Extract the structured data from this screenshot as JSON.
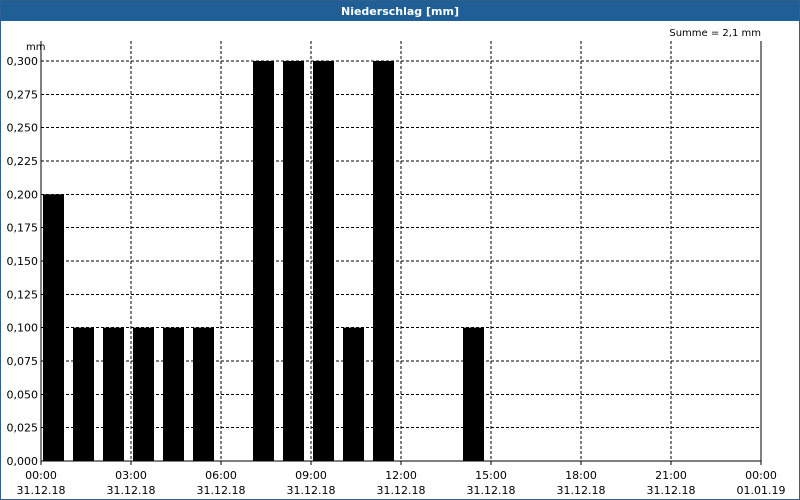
{
  "window": {
    "title": "Niederschlag [mm]"
  },
  "chart_data": {
    "type": "bar",
    "title": "Niederschlag [mm]",
    "unit": "mm",
    "summary": "Summe = 2,1 mm",
    "ylim": [
      0,
      0.3
    ],
    "y_ticks": [
      "0,000",
      "0,025",
      "0,050",
      "0,075",
      "0,100",
      "0,125",
      "0,150",
      "0,175",
      "0,200",
      "0,225",
      "0,250",
      "0,275",
      "0,300"
    ],
    "x_ticks": [
      {
        "time": "00:00",
        "date": "31.12.18"
      },
      {
        "time": "03:00",
        "date": "31.12.18"
      },
      {
        "time": "06:00",
        "date": "31.12.18"
      },
      {
        "time": "09:00",
        "date": "31.12.18"
      },
      {
        "time": "12:00",
        "date": "31.12.18"
      },
      {
        "time": "15:00",
        "date": "31.12.18"
      },
      {
        "time": "18:00",
        "date": "31.12.18"
      },
      {
        "time": "21:00",
        "date": "31.12.18"
      },
      {
        "time": "00:00",
        "date": "01.01.19"
      }
    ],
    "categories": [
      "00:00",
      "01:00",
      "02:00",
      "03:00",
      "04:00",
      "05:00",
      "06:00",
      "07:00",
      "08:00",
      "09:00",
      "10:00",
      "11:00",
      "12:00",
      "13:00",
      "14:00",
      "15:00",
      "16:00",
      "17:00",
      "18:00",
      "19:00",
      "20:00",
      "21:00",
      "22:00",
      "23:00"
    ],
    "values": [
      0.2,
      0.1,
      0.1,
      0.1,
      0.1,
      0.1,
      0,
      0.3,
      0.3,
      0.3,
      0.1,
      0.3,
      0,
      0,
      0.1,
      0,
      0,
      0,
      0,
      0,
      0,
      0,
      0,
      0
    ],
    "grid": true,
    "bar_color": "#000000"
  }
}
